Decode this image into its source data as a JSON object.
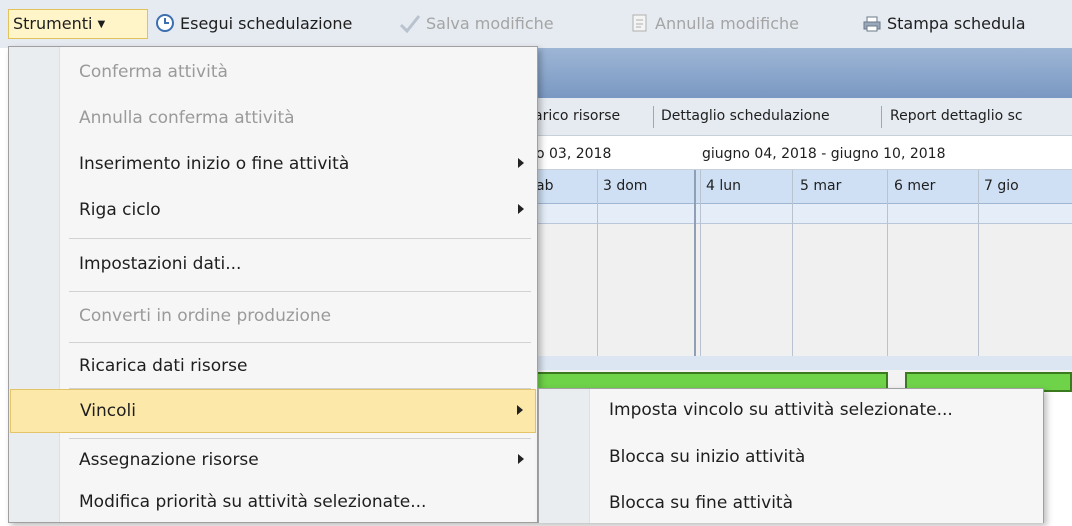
{
  "toolbar": {
    "strumenti": "Strumenti",
    "esegui": "Esegui schedulazione",
    "salva": "Salva modifiche",
    "annulla": "Annulla modifiche",
    "stampa": "Stampa schedula"
  },
  "menu": {
    "items": [
      {
        "label": "Conferma attività",
        "enabled": false,
        "submenu": false
      },
      {
        "label": "Annulla conferma attività",
        "enabled": false,
        "submenu": false
      },
      {
        "label": "Inserimento inizio o fine attività",
        "enabled": true,
        "submenu": true
      },
      {
        "label": "Riga ciclo",
        "enabled": true,
        "submenu": true
      },
      {
        "label": "Impostazioni dati...",
        "enabled": true,
        "submenu": false
      },
      {
        "label": "Converti in ordine produzione",
        "enabled": false,
        "submenu": false
      },
      {
        "label": "Ricarica dati risorse",
        "enabled": true,
        "submenu": false
      },
      {
        "label": "Vincoli",
        "enabled": true,
        "submenu": true,
        "highlighted": true
      },
      {
        "label": "Assegnazione risorse",
        "enabled": true,
        "submenu": true
      },
      {
        "label": "Modifica priorità su attività selezionate...",
        "enabled": true,
        "submenu": false
      }
    ]
  },
  "submenu": {
    "items": [
      {
        "label": "Imposta vincolo su attività selezionate..."
      },
      {
        "label": "Blocca su inizio attività"
      },
      {
        "label": "Blocca su fine attività"
      }
    ]
  },
  "background": {
    "tabs": [
      "arico risorse",
      "Dettaglio schedulazione",
      "Report dettaglio sc"
    ],
    "weeks": [
      "o 03, 2018",
      "giugno 04, 2018 - giugno 10, 2018"
    ],
    "days": [
      "ab",
      "3 dom",
      "4 lun",
      "5 mar",
      "6 mer",
      "7 gio"
    ]
  },
  "colors": {
    "toolbar_bg": "#e6ebf1",
    "menu_highlight": "#fce8a8",
    "menu_highlight_border": "#e4c468",
    "header_blue": "#7a98c2",
    "day_header": "#cfe0f5",
    "gantt_green": "#6fd34a",
    "disabled_text": "#9a9a9a"
  },
  "icons": {
    "esegui": "clock-icon",
    "salva": "checkmark-icon",
    "annulla": "cancel-document-icon",
    "stampa": "printer-icon"
  }
}
